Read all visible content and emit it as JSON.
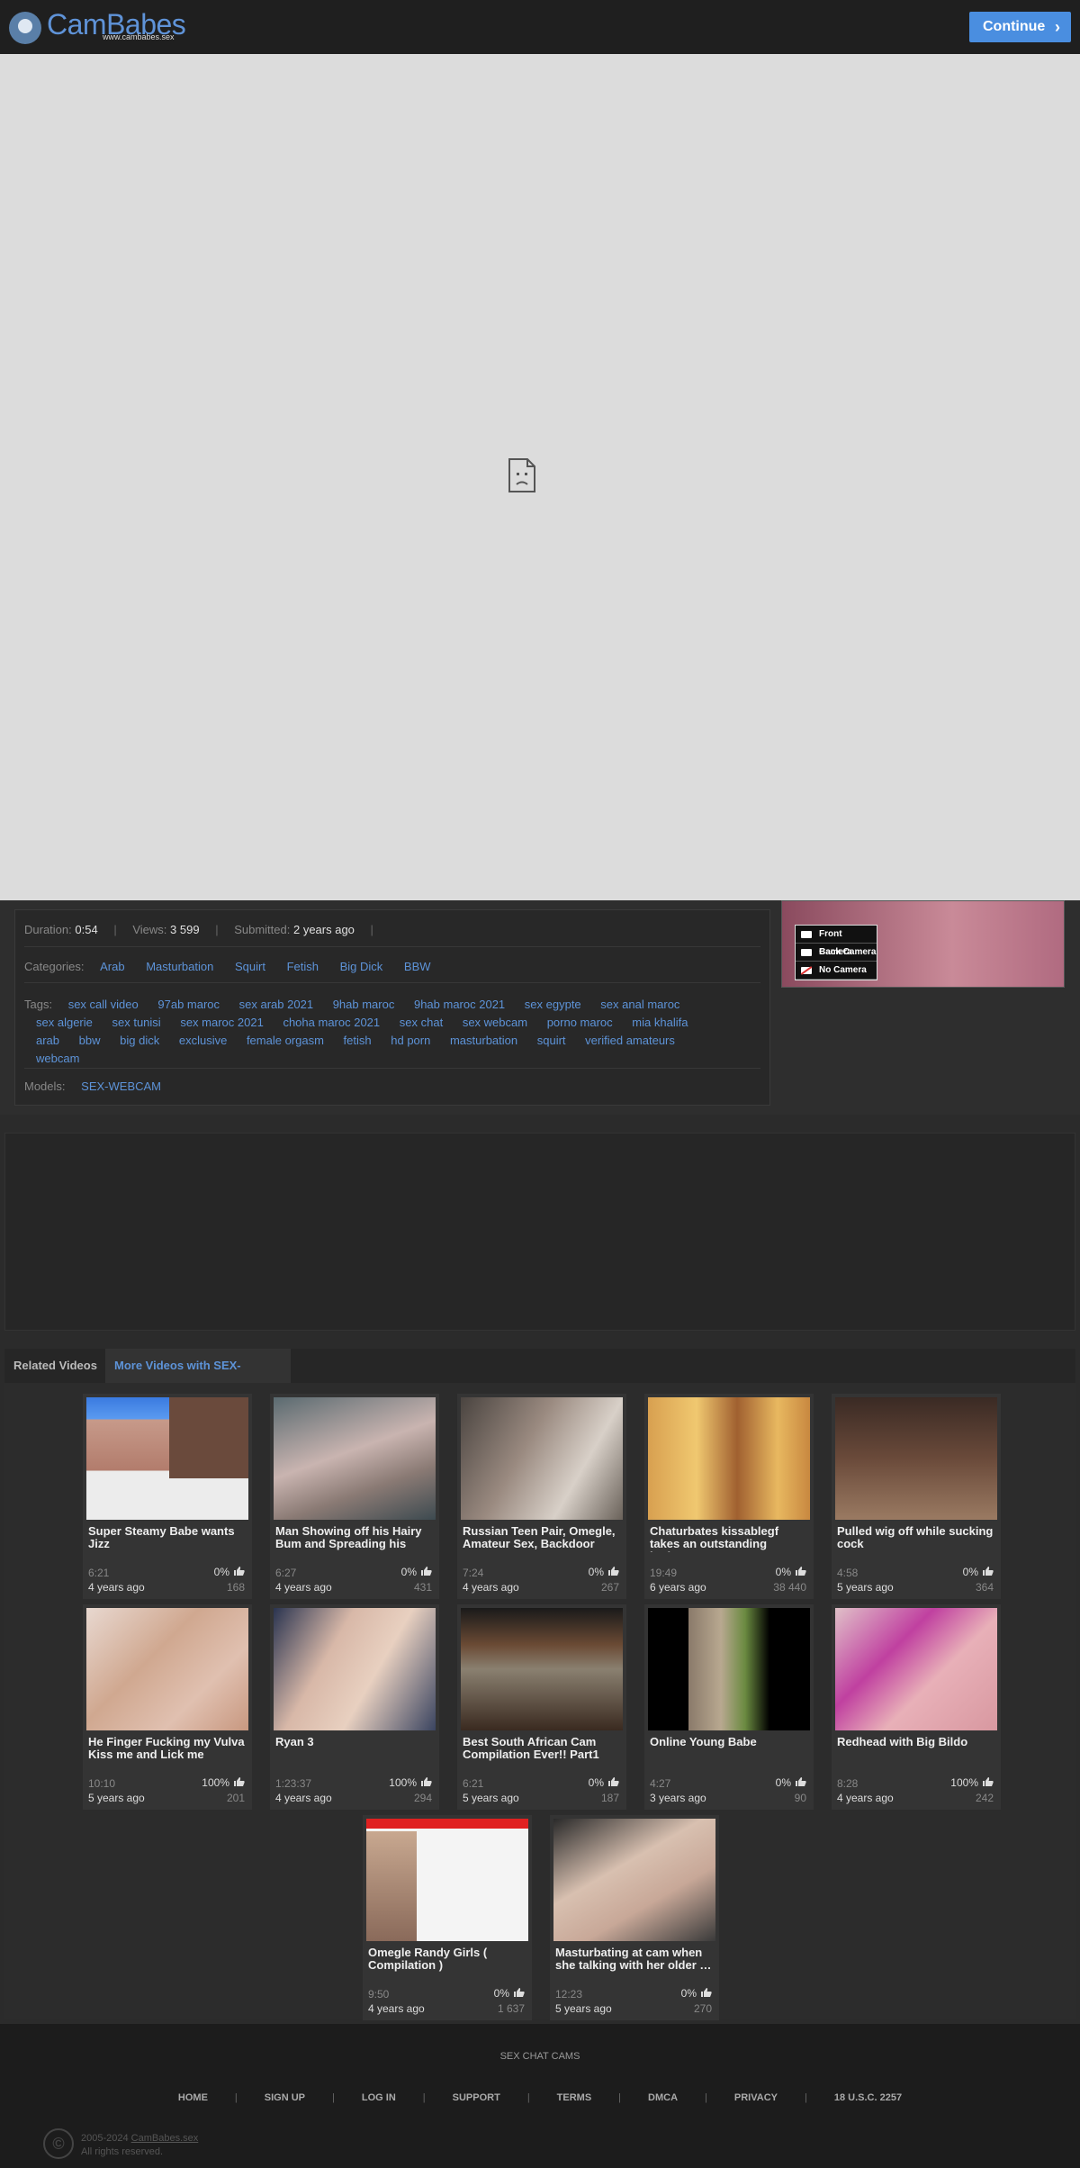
{
  "header": {
    "logo_text": "CamBabes",
    "logo_sub": "www.cambabes.sex",
    "continue_label": "Continue"
  },
  "video_info": {
    "duration_label": "Duration:",
    "duration": "0:54",
    "views_label": "Views:",
    "views": "3 599",
    "submitted_label": "Submitted:",
    "submitted": "2 years ago",
    "categories_label": "Categories:",
    "categories": [
      "Arab",
      "Masturbation",
      "Squirt",
      "Fetish",
      "Big Dick",
      "BBW"
    ],
    "tags_label": "Tags:",
    "tags": [
      "sex call video",
      "97ab maroc",
      "sex arab 2021",
      "9hab maroc",
      "9hab maroc 2021",
      "sex egypte",
      "sex anal maroc",
      "sex algerie",
      "sex tunisi",
      "sex maroc 2021",
      "choha maroc 2021",
      "sex chat",
      "sex webcam",
      "porno maroc",
      "mia khalifa",
      "arab",
      "bbw",
      "big dick",
      "exclusive",
      "female orgasm",
      "fetish",
      "hd porn",
      "masturbation",
      "squirt",
      "verified amateurs",
      "webcam"
    ],
    "models_label": "Models:",
    "models": [
      "SEX-WEBCAM"
    ]
  },
  "side_ad": {
    "menu": [
      "Front Camera",
      "Back Camera",
      "No Camera"
    ]
  },
  "tabs": [
    "Related Videos",
    "More Videos with SEX-WEBCAM"
  ],
  "videos": [
    {
      "title": "Super Steamy Babe wants Jizz",
      "duration": "6:21",
      "rating": "0%",
      "age": "4 years ago",
      "views": "168"
    },
    {
      "title": "Man Showing off his Hairy Bum and Spreading his",
      "duration": "6:27",
      "rating": "0%",
      "age": "4 years ago",
      "views": "431"
    },
    {
      "title": "Russian Teen Pair, Omegle, Amateur Sex, Backdoor Sex…",
      "duration": "7:24",
      "rating": "0%",
      "age": "4 years ago",
      "views": "267"
    },
    {
      "title": "Chaturbates kissablegf takes an outstanding bathroom…",
      "duration": "19:49",
      "rating": "0%",
      "age": "6 years ago",
      "views": "38 440"
    },
    {
      "title": "Pulled wig off while sucking cock",
      "duration": "4:58",
      "rating": "0%",
      "age": "5 years ago",
      "views": "364"
    },
    {
      "title": "He Finger Fucking my Vulva Kiss me and Lick me",
      "duration": "10:10",
      "rating": "100%",
      "age": "5 years ago",
      "views": "201"
    },
    {
      "title": "Ryan 3",
      "duration": "1:23:37",
      "rating": "100%",
      "age": "4 years ago",
      "views": "294"
    },
    {
      "title": "Best South African Cam Compilation Ever!! Part1",
      "duration": "6:21",
      "rating": "0%",
      "age": "5 years ago",
      "views": "187"
    },
    {
      "title": "Online Young Babe",
      "duration": "4:27",
      "rating": "0%",
      "age": "3 years ago",
      "views": "90"
    },
    {
      "title": "Redhead with Big Bildo",
      "duration": "8:28",
      "rating": "100%",
      "age": "4 years ago",
      "views": "242"
    },
    {
      "title": "Omegle Randy Girls ( Compilation )",
      "duration": "9:50",
      "rating": "0%",
      "age": "4 years ago",
      "views": "1 637"
    },
    {
      "title": "Masturbating at cam when she talking with her older …",
      "duration": "12:23",
      "rating": "0%",
      "age": "5 years ago",
      "views": "270"
    }
  ],
  "footer": {
    "title": "SEX CHAT CAMS",
    "nav": [
      "HOME",
      "SIGN UP",
      "LOG IN",
      "SUPPORT",
      "TERMS",
      "DMCA",
      "PRIVACY",
      "18 U.S.C. 2257"
    ],
    "copyright_years": "2005-2024",
    "copyright_site": "CamBabes.sex",
    "rights": "All rights reserved."
  },
  "colors": {
    "accent": "#5d93d8",
    "button": "#4a8ee0",
    "header_bg": "#1f1f1f",
    "player_bg": "#dcdcdc"
  }
}
